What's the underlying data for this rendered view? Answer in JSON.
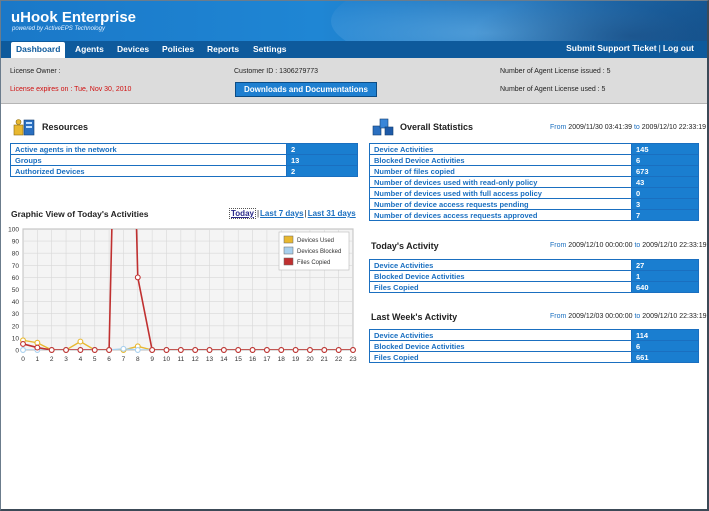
{
  "header": {
    "title": "uHook Enterprise",
    "subtitle": "powered by ActiveEPS Technology"
  },
  "nav": {
    "items": [
      {
        "label": "Dashboard"
      },
      {
        "label": "Agents"
      },
      {
        "label": "Devices"
      },
      {
        "label": "Policies"
      },
      {
        "label": "Reports"
      },
      {
        "label": "Settings"
      }
    ],
    "support_label": "Submit Support Ticket",
    "separator": "|",
    "logout_label": "Log out"
  },
  "license": {
    "owner": "License Owner :",
    "expires": "License expires on : Tue, Nov 30, 2010",
    "customer_id": "Customer ID : 1306279773",
    "issued": "Number of Agent License issued : 5",
    "used": "Number of Agent License used : 5",
    "downloads_label": "Downloads and Documentations"
  },
  "resources": {
    "title": "Resources",
    "rows": [
      {
        "label": "Active agents in the network",
        "value": "2"
      },
      {
        "label": "Groups",
        "value": "13"
      },
      {
        "label": "Authorized Devices",
        "value": "2"
      }
    ]
  },
  "overall": {
    "title": "Overall Statistics",
    "range_from_word": "From",
    "range_from": "2009/11/30 03:41:39",
    "range_to_word": "to",
    "range_to": "2009/12/10 22:33:19",
    "rows": [
      {
        "label": "Device Activities",
        "value": "145"
      },
      {
        "label": "Blocked Device Activities",
        "value": "6"
      },
      {
        "label": "Number of files copied",
        "value": "673"
      },
      {
        "label": "Number of devices used with read-only policy",
        "value": "43"
      },
      {
        "label": "Number of devices used with full access policy",
        "value": "0"
      },
      {
        "label": "Number of device access requests pending",
        "value": "3"
      },
      {
        "label": "Number of devices access requests approved",
        "value": "7"
      }
    ]
  },
  "today": {
    "title": "Today's Activity",
    "range_from_word": "From",
    "range_from": "2009/12/10 00:00:00",
    "range_to_word": "to",
    "range_to": "2009/12/10 22:33:19",
    "rows": [
      {
        "label": "Device Activities",
        "value": "27"
      },
      {
        "label": "Blocked Device Activities",
        "value": "1"
      },
      {
        "label": "Files Copied",
        "value": "640"
      }
    ]
  },
  "week": {
    "title": "Last Week's Activity",
    "range_from_word": "From",
    "range_from": "2009/12/03 00:00:00",
    "range_to_word": "to",
    "range_to": "2009/12/10 22:33:19",
    "rows": [
      {
        "label": "Device Activities",
        "value": "114"
      },
      {
        "label": "Blocked Device Activities",
        "value": "6"
      },
      {
        "label": "Files Copied",
        "value": "661"
      }
    ]
  },
  "graph": {
    "title": "Graphic View of Today's Activities",
    "links": [
      {
        "label": "Today"
      },
      {
        "label": "Last 7 days"
      },
      {
        "label": "Last 31 days"
      }
    ],
    "link_sep": "|"
  },
  "colors": {
    "brand_blue": "#1a7ed0",
    "nav_blue": "#0e5a9c",
    "alert_red": "#d01010",
    "series_used": "#e8b830",
    "series_blocked": "#a8d0ee",
    "series_copied": "#c03030"
  },
  "chart_data": {
    "type": "line",
    "x": [
      0,
      1,
      2,
      3,
      4,
      5,
      6,
      7,
      8,
      9,
      10,
      11,
      12,
      13,
      14,
      15,
      16,
      17,
      18,
      19,
      20,
      21,
      22,
      23
    ],
    "ylim": [
      0,
      100
    ],
    "yticks": [
      0,
      10,
      20,
      30,
      40,
      50,
      60,
      70,
      80,
      90,
      100
    ],
    "grid": true,
    "legend_position": "top-right",
    "series": [
      {
        "name": "Devices Used",
        "color": "#e8b830",
        "values": [
          8,
          6,
          0,
          0,
          7,
          0,
          0,
          0,
          3,
          0,
          0,
          0,
          0,
          0,
          0,
          0,
          0,
          0,
          0,
          0,
          0,
          0,
          0,
          0
        ]
      },
      {
        "name": "Devices Blocked",
        "color": "#a8d0ee",
        "values": [
          0,
          0,
          0,
          0,
          0,
          0,
          0,
          1,
          0,
          0,
          0,
          0,
          0,
          0,
          0,
          0,
          0,
          0,
          0,
          0,
          0,
          0,
          0,
          0
        ]
      },
      {
        "name": "Files Copied",
        "color": "#c03030",
        "values": [
          5,
          2,
          0,
          0,
          0,
          0,
          0,
          520,
          60,
          0,
          0,
          0,
          0,
          0,
          0,
          0,
          0,
          0,
          0,
          0,
          0,
          0,
          0,
          0
        ]
      }
    ]
  }
}
